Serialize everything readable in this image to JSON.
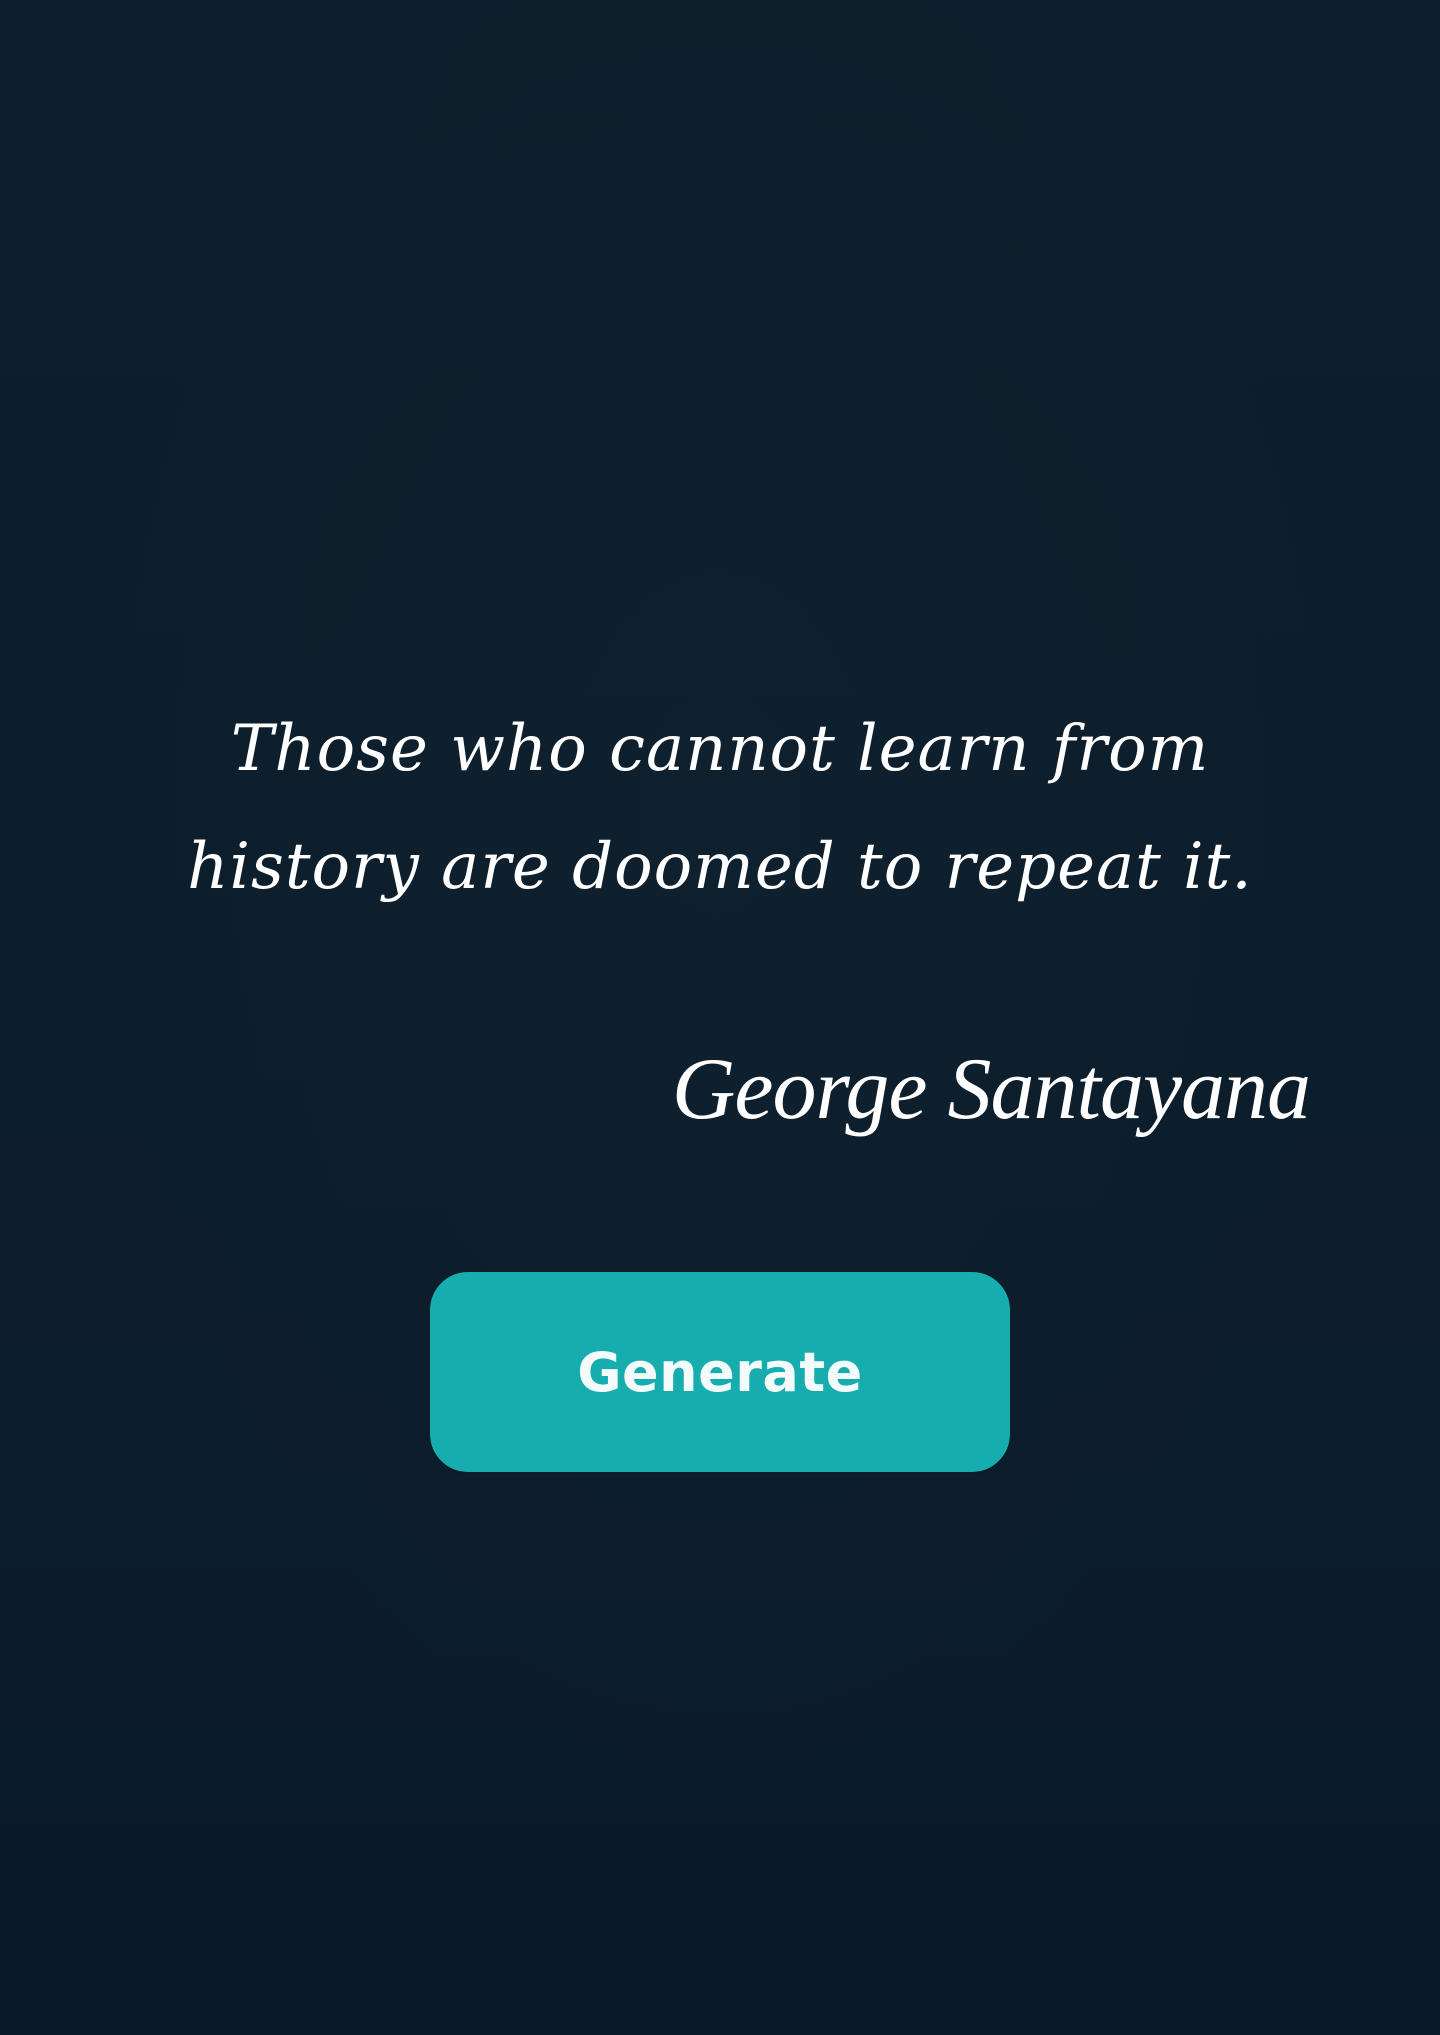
{
  "quote": {
    "text": "Those who cannot learn from history are doomed to repeat it.",
    "author": "George Santayana"
  },
  "actions": {
    "generate_label": "Generate"
  },
  "colors": {
    "background": "#0c1d2b",
    "text": "#ffffff",
    "button": "#17adaf"
  }
}
